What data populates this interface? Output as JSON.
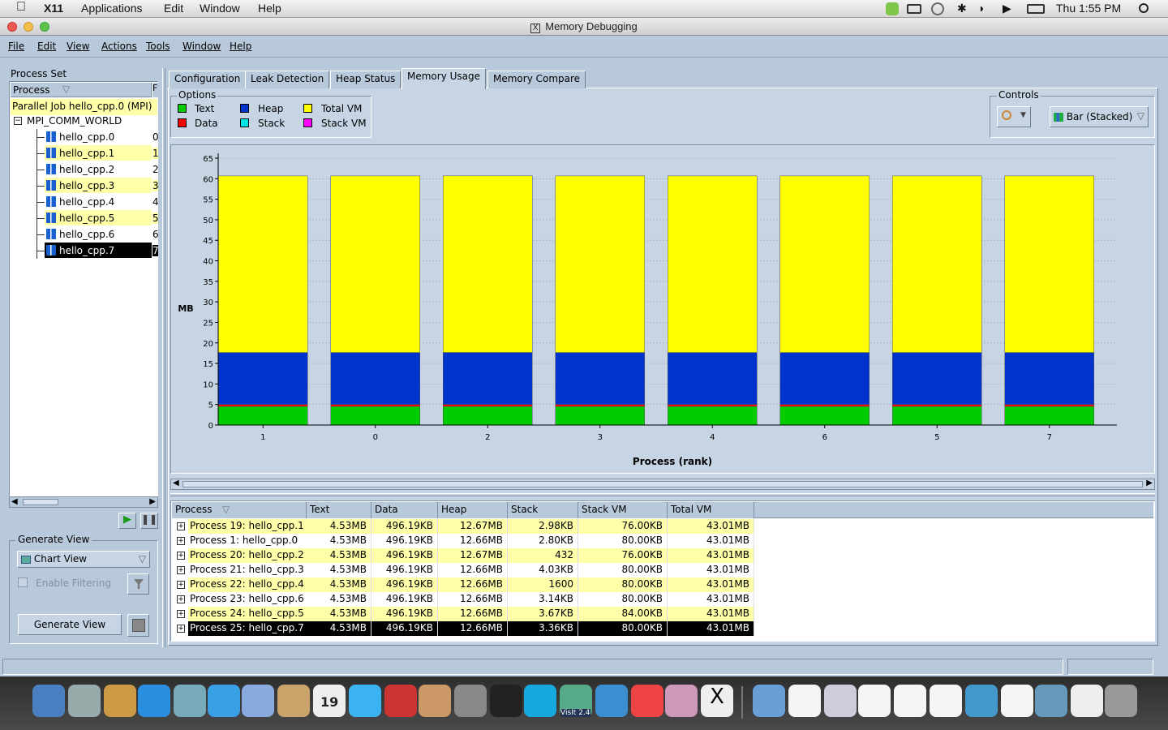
{
  "macmenu": {
    "app": "X11",
    "items": [
      "Applications",
      "Edit",
      "Window",
      "Help"
    ],
    "clock": "Thu 1:55 PM"
  },
  "window": {
    "title": "Memory Debugging"
  },
  "menu": [
    "File",
    "Edit",
    "View",
    "Actions",
    "Tools",
    "Window",
    "Help"
  ],
  "process_set": {
    "label": "Process Set",
    "header": "Process",
    "header2": "F",
    "job": "Parallel Job hello_cpp.0 (MPI)",
    "group": "MPI_COMM_WORLD",
    "items": [
      {
        "name": "hello_cpp.0",
        "rank": "0"
      },
      {
        "name": "hello_cpp.1",
        "rank": "1"
      },
      {
        "name": "hello_cpp.2",
        "rank": "2"
      },
      {
        "name": "hello_cpp.3",
        "rank": "3"
      },
      {
        "name": "hello_cpp.4",
        "rank": "4"
      },
      {
        "name": "hello_cpp.5",
        "rank": "5"
      },
      {
        "name": "hello_cpp.6",
        "rank": "6"
      },
      {
        "name": "hello_cpp.7",
        "rank": "7"
      }
    ]
  },
  "generate_view": {
    "label": "Generate View",
    "view_select": "Chart View",
    "enable_filtering": "Enable Filtering",
    "button": "Generate View"
  },
  "tabs": [
    "Configuration",
    "Leak Detection",
    "Heap Status",
    "Memory Usage",
    "Memory Compare"
  ],
  "options": {
    "label": "Options",
    "legend": [
      {
        "name": "Text",
        "color": "#00cc00"
      },
      {
        "name": "Data",
        "color": "#ff0000"
      },
      {
        "name": "Heap",
        "color": "#0033cc"
      },
      {
        "name": "Stack",
        "color": "#00e5e5"
      },
      {
        "name": "Total VM",
        "color": "#ffff00"
      },
      {
        "name": "Stack VM",
        "color": "#ff00ff"
      }
    ]
  },
  "controls": {
    "label": "Controls",
    "chart_type": "Bar (Stacked)"
  },
  "chart_data": {
    "type": "bar",
    "stacked": true,
    "categories": [
      "1",
      "0",
      "2",
      "3",
      "4",
      "6",
      "5",
      "7"
    ],
    "series": [
      {
        "name": "Text",
        "color": "#00cc00",
        "values": [
          4.53,
          4.53,
          4.53,
          4.53,
          4.53,
          4.53,
          4.53,
          4.53
        ]
      },
      {
        "name": "Data",
        "color": "#ff0000",
        "values": [
          0.48,
          0.48,
          0.48,
          0.48,
          0.48,
          0.48,
          0.48,
          0.48
        ]
      },
      {
        "name": "Heap",
        "color": "#0033cc",
        "values": [
          12.66,
          12.66,
          12.67,
          12.66,
          12.66,
          12.66,
          12.66,
          12.66
        ]
      },
      {
        "name": "Total VM",
        "color": "#ffff00",
        "values": [
          43.01,
          43.01,
          43.01,
          43.01,
          43.01,
          43.01,
          43.01,
          43.01
        ]
      }
    ],
    "ylabel": "MB",
    "xlabel": "Process (rank)",
    "ylim": [
      0,
      65
    ],
    "yticks": [
      0,
      5,
      10,
      15,
      20,
      25,
      30,
      35,
      40,
      45,
      50,
      55,
      60,
      65
    ],
    "grid": true
  },
  "table": {
    "columns": [
      "Process",
      "Text",
      "Data",
      "Heap",
      "Stack",
      "Stack VM",
      "Total VM"
    ],
    "rows": [
      [
        "Process 19: hello_cpp.1",
        "4.53MB",
        "496.19KB",
        "12.67MB",
        "2.98KB",
        "76.00KB",
        "43.01MB"
      ],
      [
        "Process 1: hello_cpp.0",
        "4.53MB",
        "496.19KB",
        "12.66MB",
        "2.80KB",
        "80.00KB",
        "43.01MB"
      ],
      [
        "Process 20: hello_cpp.2",
        "4.53MB",
        "496.19KB",
        "12.67MB",
        "432",
        "76.00KB",
        "43.01MB"
      ],
      [
        "Process 21: hello_cpp.3",
        "4.53MB",
        "496.19KB",
        "12.66MB",
        "4.03KB",
        "80.00KB",
        "43.01MB"
      ],
      [
        "Process 22: hello_cpp.4",
        "4.53MB",
        "496.19KB",
        "12.66MB",
        "1600",
        "80.00KB",
        "43.01MB"
      ],
      [
        "Process 23: hello_cpp.6",
        "4.53MB",
        "496.19KB",
        "12.66MB",
        "3.14KB",
        "80.00KB",
        "43.01MB"
      ],
      [
        "Process 24: hello_cpp.5",
        "4.53MB",
        "496.19KB",
        "12.66MB",
        "3.67KB",
        "84.00KB",
        "43.01MB"
      ],
      [
        "Process 25: hello_cpp.7",
        "4.53MB",
        "496.19KB",
        "12.66MB",
        "3.36KB",
        "80.00KB",
        "43.01MB"
      ]
    ]
  },
  "dock": {
    "visit_label": "VisIt 2.4",
    "calendar_day": "19"
  }
}
